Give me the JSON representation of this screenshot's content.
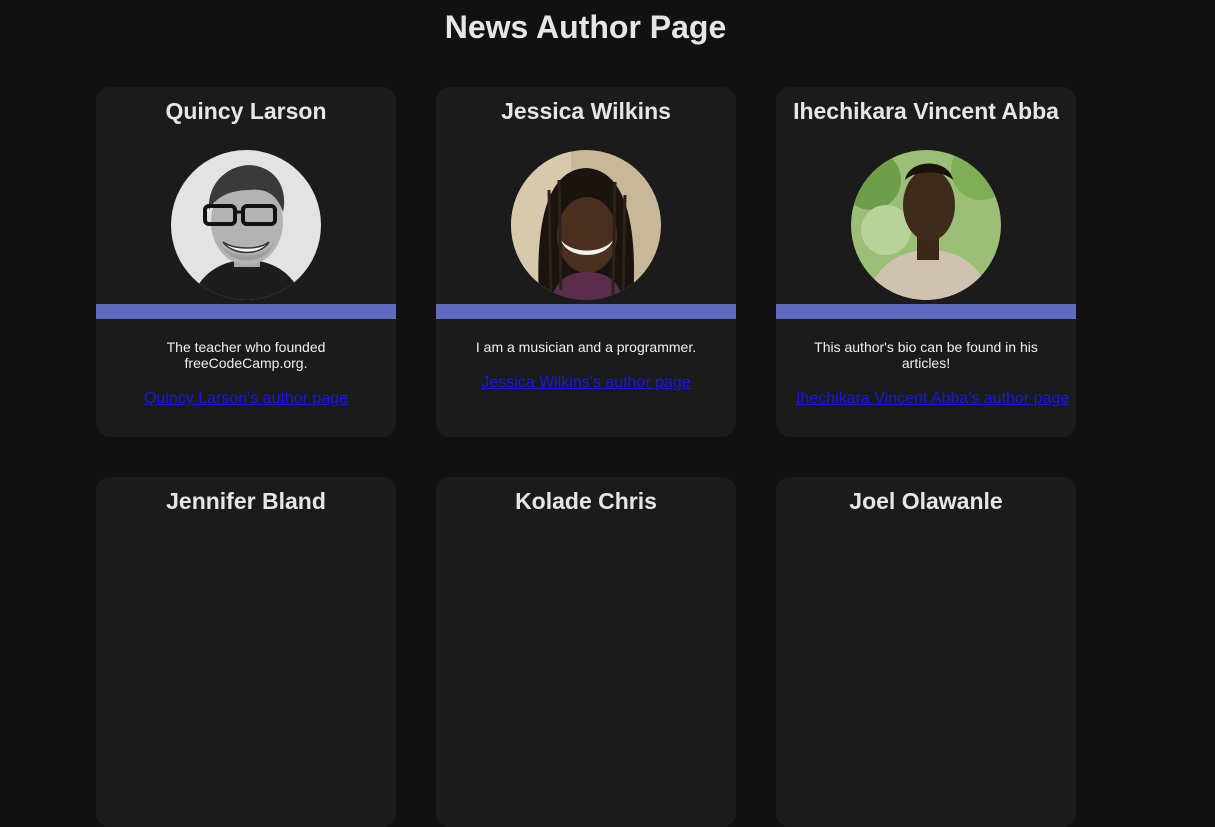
{
  "page": {
    "title": "News Author Page",
    "background": "#111111",
    "card_background": "#1b1b1b",
    "accent_bar": "#5e6bbf",
    "link_color": "#1a17e0"
  },
  "authors": [
    {
      "name": "Quincy Larson",
      "bio": "The teacher who founded freeCodeCamp.org.",
      "link": "Quincy Larson's author page",
      "avatar": "quincy-avatar"
    },
    {
      "name": "Jessica Wilkins",
      "bio": "I am a musician and a programmer.",
      "link": "Jessica Wilkins's author page",
      "avatar": "jessica-avatar"
    },
    {
      "name": "Ihechikara Vincent Abba",
      "bio": "This author's bio can be found in his articles!",
      "link": "Ihechikara Vincent Abba's author page",
      "avatar": "ihechikara-avatar"
    },
    {
      "name": "Jennifer Bland"
    },
    {
      "name": "Kolade Chris"
    },
    {
      "name": "Joel Olawanle"
    }
  ]
}
